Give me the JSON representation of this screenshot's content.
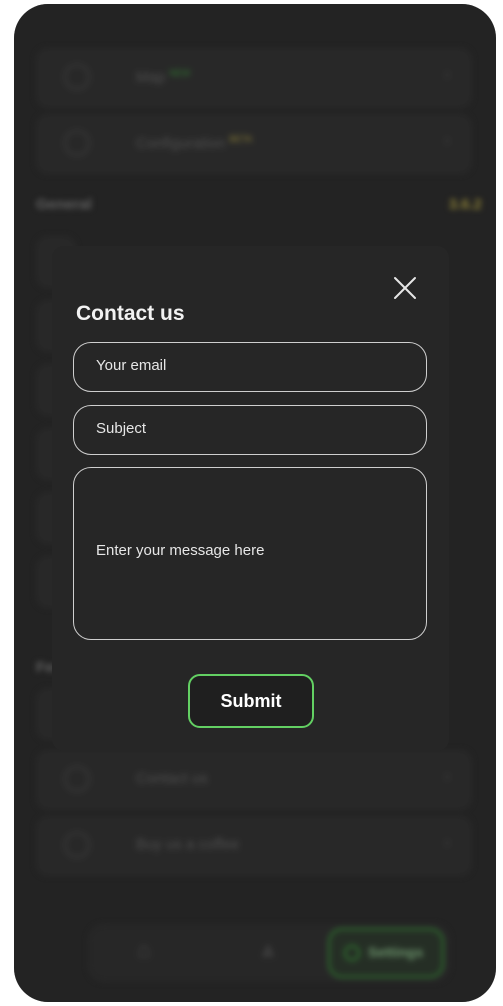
{
  "background": {
    "rows_top": [
      {
        "label": "Map",
        "badge": "NEW",
        "badge_color": "#3fae3f"
      },
      {
        "label": "Configuration",
        "badge": "BETA",
        "badge_color": "#c9b84a"
      }
    ],
    "section_general": "General",
    "version": "3.6.2",
    "section_feedback": "Feedback",
    "rows_bottom": [
      {
        "label": "Contact us"
      },
      {
        "label": "Buy us a coffee"
      }
    ],
    "tabbar": {
      "settings_label": "Settings"
    }
  },
  "modal": {
    "title": "Contact us",
    "email_placeholder": "Your email",
    "subject_placeholder": "Subject",
    "message_placeholder": "Enter your message here",
    "submit_label": "Submit"
  },
  "colors": {
    "accent": "#63d063",
    "modal_bg": "#262626",
    "screen_bg": "#2b2b2b"
  }
}
